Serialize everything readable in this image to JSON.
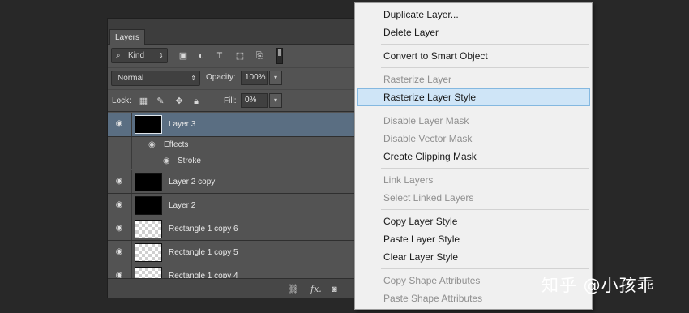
{
  "panel": {
    "tab_label": "Layers",
    "filter": {
      "kind_label": "Kind"
    },
    "blend_mode": "Normal",
    "opacity_label": "Opacity:",
    "opacity_value": "100%",
    "lock_label": "Lock:",
    "fill_label": "Fill:",
    "fill_value": "0%",
    "layers": [
      {
        "name": "Layer 3",
        "selected": true
      },
      {
        "name": "Effects"
      },
      {
        "name": "Stroke"
      },
      {
        "name": "Layer 2 copy"
      },
      {
        "name": "Layer 2"
      },
      {
        "name": "Rectangle 1 copy 6"
      },
      {
        "name": "Rectangle 1 copy 5"
      },
      {
        "name": "Rectangle 1 copy 4"
      }
    ],
    "footer_fx": "fx."
  },
  "menu": {
    "items": [
      {
        "label": "Duplicate Layer...",
        "enabled": true
      },
      {
        "label": "Delete Layer",
        "enabled": true
      },
      {
        "label": "Convert to Smart Object",
        "enabled": true
      },
      {
        "label": "Rasterize Layer",
        "enabled": false
      },
      {
        "label": "Rasterize Layer Style",
        "enabled": true,
        "highlighted": true
      },
      {
        "label": "Disable Layer Mask",
        "enabled": false
      },
      {
        "label": "Disable Vector Mask",
        "enabled": false
      },
      {
        "label": "Create Clipping Mask",
        "enabled": true
      },
      {
        "label": "Link Layers",
        "enabled": false
      },
      {
        "label": "Select Linked Layers",
        "enabled": false
      },
      {
        "label": "Copy Layer Style",
        "enabled": true
      },
      {
        "label": "Paste Layer Style",
        "enabled": true
      },
      {
        "label": "Clear Layer Style",
        "enabled": true
      },
      {
        "label": "Copy Shape Attributes",
        "enabled": false
      },
      {
        "label": "Paste Shape Attributes",
        "enabled": false
      }
    ]
  },
  "watermark": "知乎 @小孩乖",
  "colors": {
    "panel_bg": "#535353",
    "selected_layer": "#5a6e82",
    "menu_highlight": "#cfe5f7"
  }
}
